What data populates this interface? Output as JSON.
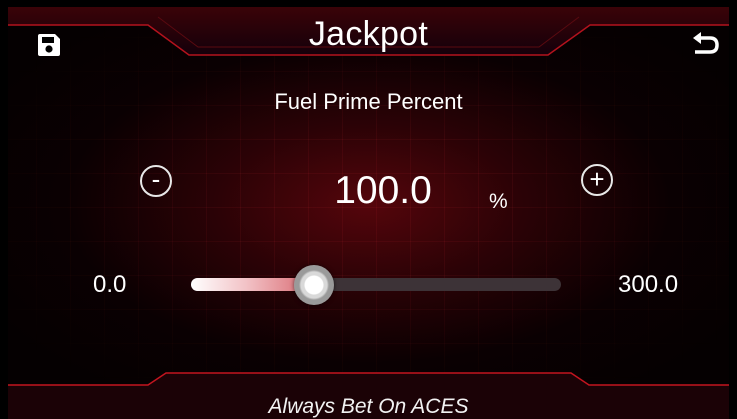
{
  "header": {
    "title": "Jackpot"
  },
  "toolbar": {
    "save_icon": "floppy-disk-icon",
    "back_icon": "undo-arrow-icon"
  },
  "parameter": {
    "label": "Fuel Prime Percent",
    "value": "100.0",
    "unit": "%",
    "min": "0.0",
    "max": "300.0",
    "fraction": 0.333
  },
  "controls": {
    "decrement": "-",
    "increment": "+"
  },
  "footer": {
    "tagline": "Always Bet On ACES"
  },
  "colors": {
    "accent": "#c0101c",
    "track": "#3d3337",
    "fill": "#d8676f"
  }
}
